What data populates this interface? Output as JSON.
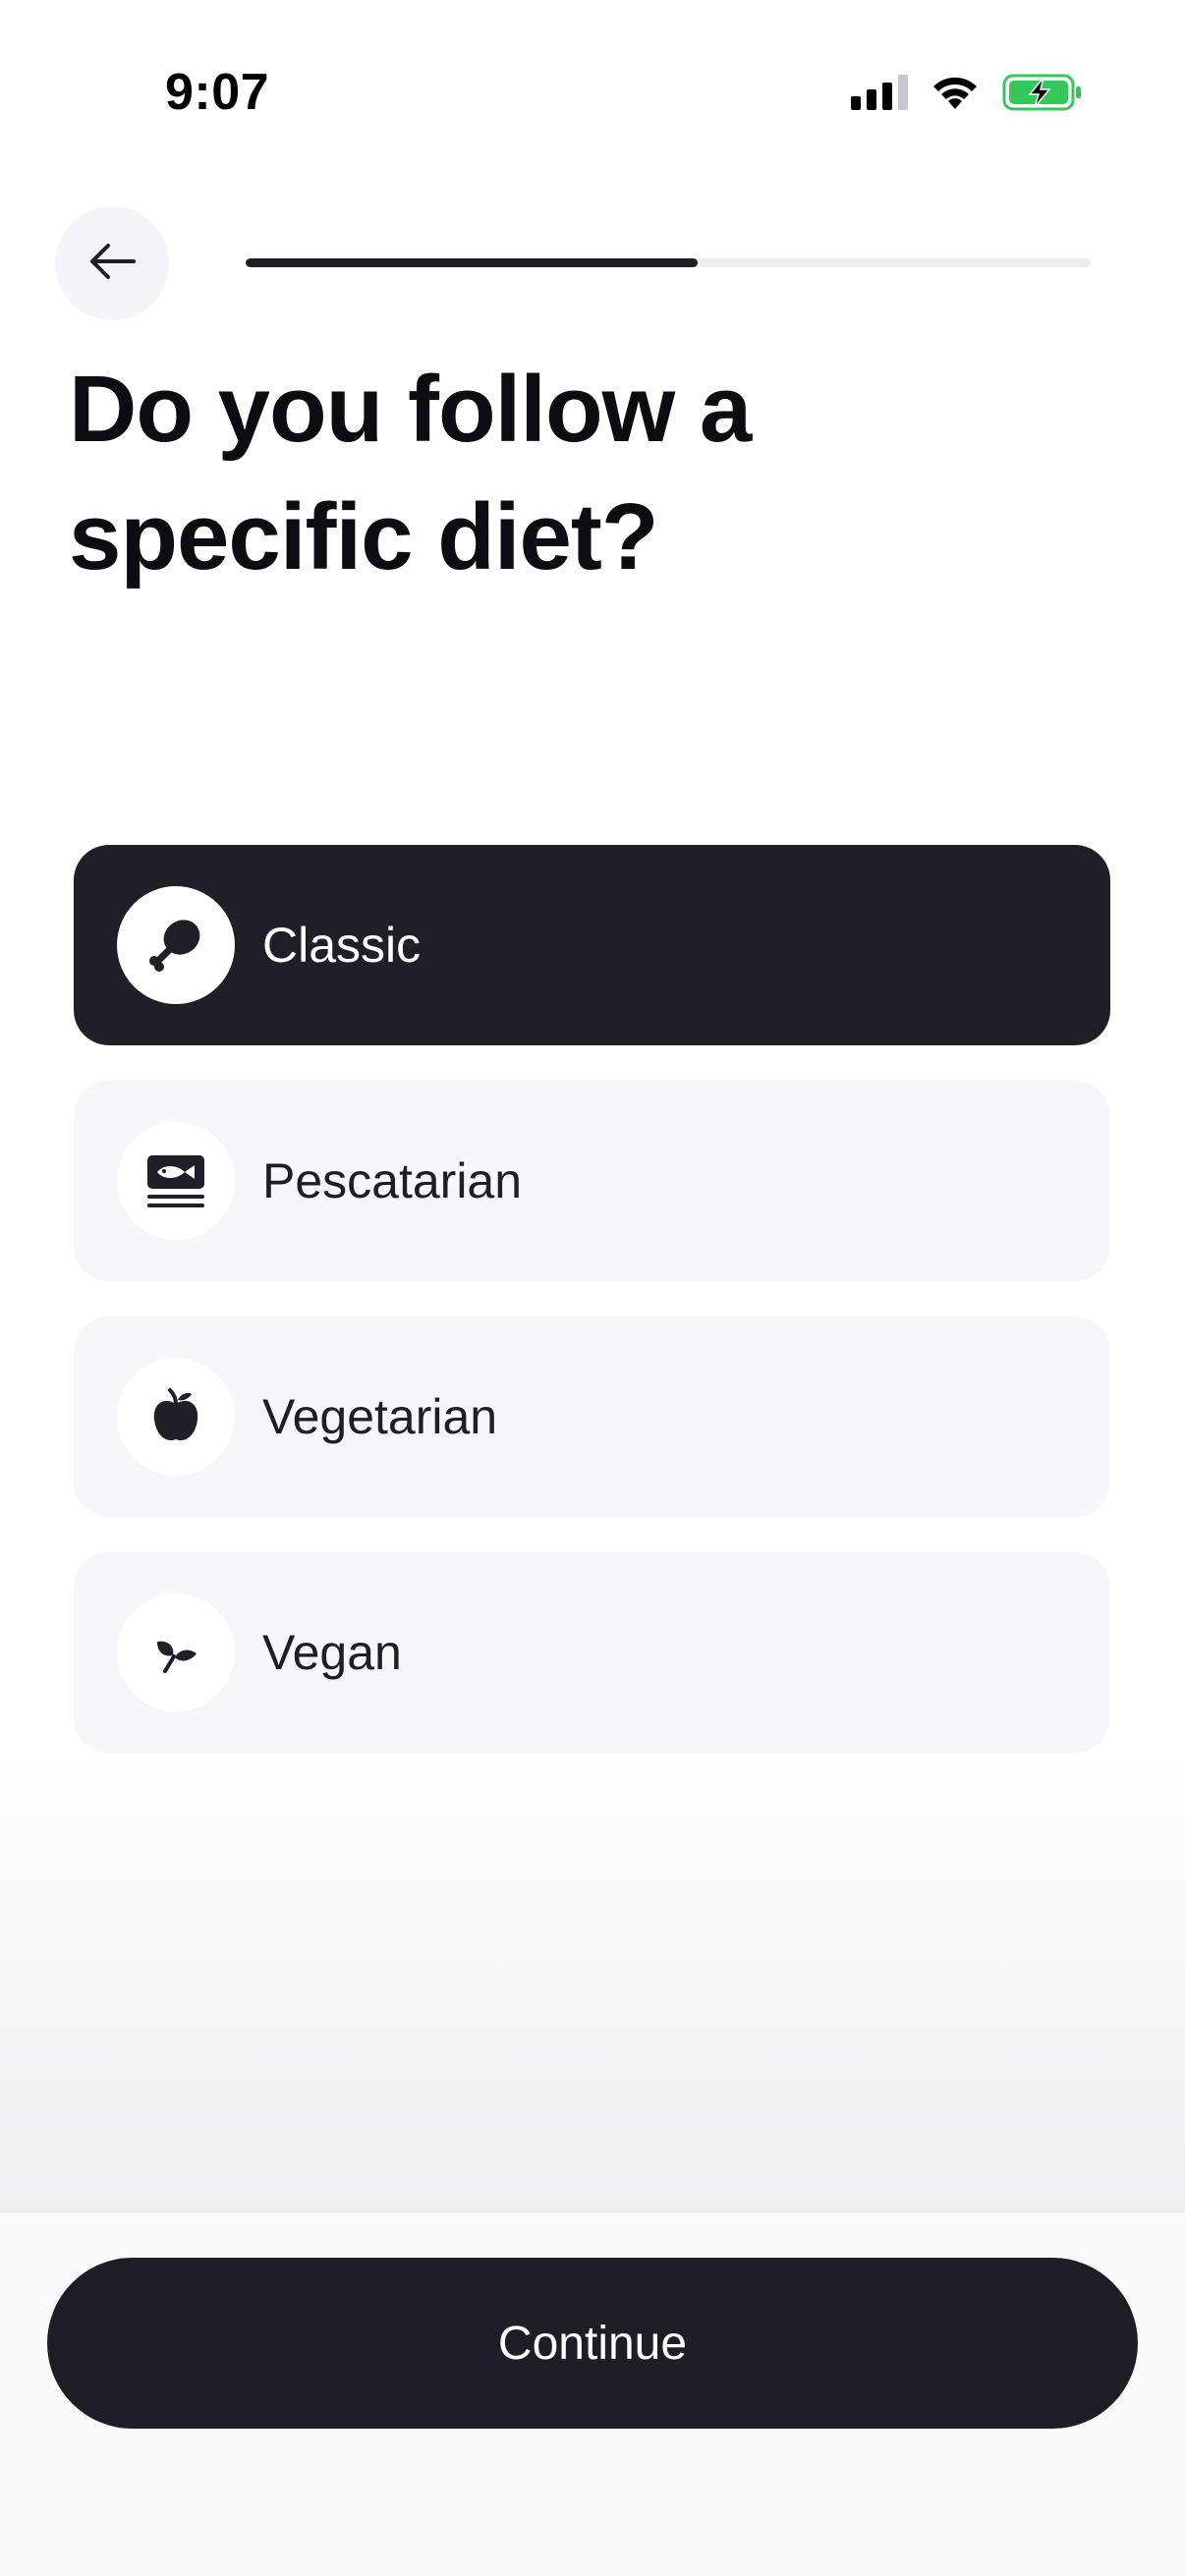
{
  "status_bar": {
    "time": "9:07",
    "icons": [
      "cellular-signal-icon",
      "wifi-icon",
      "battery-charging-icon"
    ],
    "battery_color": "#34c759"
  },
  "header": {
    "back_icon": "arrow-left-icon",
    "progress_fraction": 0.535
  },
  "title": "Do you follow a specific diet?",
  "options": [
    {
      "label": "Classic",
      "icon": "drumstick-icon",
      "selected": true
    },
    {
      "label": "Pescatarian",
      "icon": "fish-icon",
      "selected": false
    },
    {
      "label": "Vegetarian",
      "icon": "apple-icon",
      "selected": false
    },
    {
      "label": "Vegan",
      "icon": "leaf-icon",
      "selected": false
    }
  ],
  "continue_label": "Continue",
  "colors": {
    "primary": "#1f1d26",
    "option_bg": "#f7f7fb",
    "track": "#ececee"
  }
}
